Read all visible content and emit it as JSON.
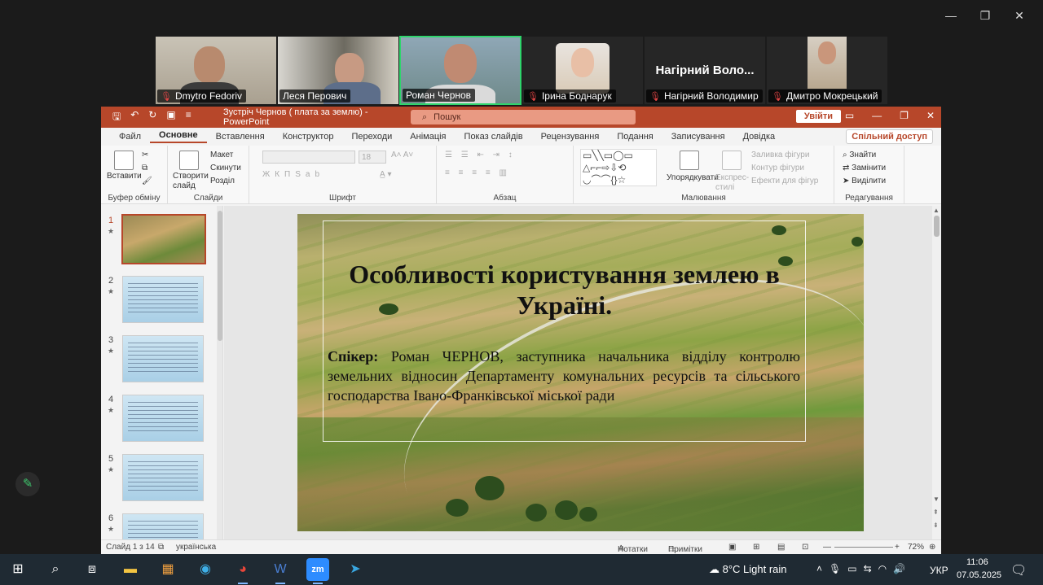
{
  "participants": [
    {
      "name": "Dmytro Fedoriv",
      "muted": true
    },
    {
      "name": "Леся Перович",
      "muted": false
    },
    {
      "name": "Роман Чернов",
      "muted": false,
      "active": true
    },
    {
      "name": "Ірина Боднарук",
      "muted": true
    },
    {
      "name": "Нагірний Володимир",
      "muted": true,
      "display": "Нагірний  Воло..."
    },
    {
      "name": "Дмитро Мокрецький",
      "muted": true
    }
  ],
  "ppt": {
    "title": "Зустріч Чернов ( плата за землю)  -  PowerPoint",
    "search_placeholder": "Пошук",
    "signin": "Увійти",
    "share": "Спільний доступ",
    "tabs": [
      "Файл",
      "Основне",
      "Вставлення",
      "Конструктор",
      "Переходи",
      "Анімація",
      "Показ слайдів",
      "Рецензування",
      "Подання",
      "Записування",
      "Довідка"
    ],
    "selected_tab": "Основне",
    "groups": {
      "clipboard": {
        "label": "Буфер обміну",
        "paste": "Вставити"
      },
      "slides": {
        "label": "Слайди",
        "new_slide": "Створити слайд",
        "layout": "Макет",
        "reset": "Скинути",
        "section": "Розділ"
      },
      "font": {
        "label": "Шрифт",
        "size": "18"
      },
      "paragraph": {
        "label": "Абзац"
      },
      "drawing": {
        "label": "Малювання",
        "arrange": "Упорядкувати",
        "quick_styles": "Експрес-стилі",
        "fill": "Заливка фігури",
        "outline": "Контур фігури",
        "effects": "Ефекти для фігур"
      },
      "editing": {
        "label": "Редагування",
        "find": "Знайти",
        "replace": "Замінити",
        "select": "Виділити"
      }
    },
    "slide": {
      "title": "Особливості користування землею в Україні.",
      "speaker_label": "Спікер:",
      "speaker_text": " Роман ЧЕРНОВ, заступника начальника відділу контролю земельних відносин Департаменту комунальних ресурсів та сільського господарства Івано-Франківської міської ради"
    },
    "thumbnails": [
      "1",
      "2",
      "3",
      "4",
      "5",
      "6"
    ],
    "status": {
      "slide_count": "Слайд 1 з 14",
      "language": "українська",
      "notes": "Нотатки",
      "comments": "Примітки",
      "zoom": "72%"
    }
  },
  "taskbar": {
    "weather": "8°C  Light rain",
    "lang": "УКР",
    "time": "11:06",
    "date": "07.05.2025"
  }
}
